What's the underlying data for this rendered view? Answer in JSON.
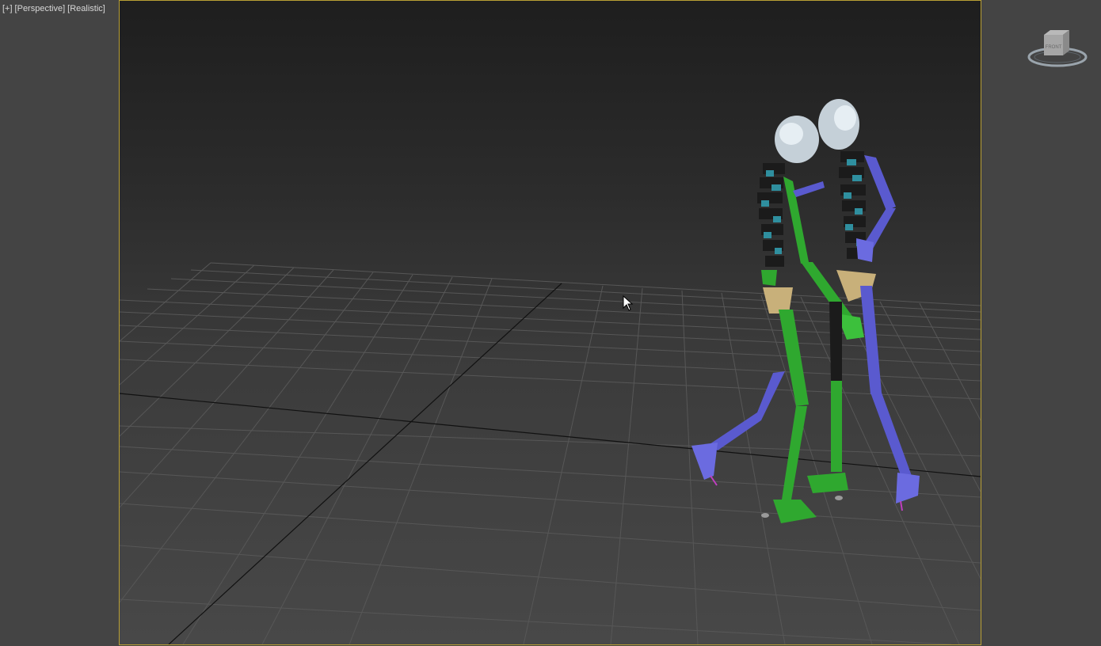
{
  "viewport_menu": {
    "plus_label": "[+]",
    "view_label": "[Perspective]",
    "shading_label": "[Realistic]"
  },
  "viewcube": {
    "face_label": "FRONT",
    "icon": "viewcube-icon"
  },
  "scene": {
    "objects": [
      {
        "name": "biped-skeleton-left",
        "colors": [
          "#2fa82f",
          "#5a5acf",
          "#2f8f9f"
        ]
      },
      {
        "name": "biped-skeleton-right",
        "colors": [
          "#5a5acf",
          "#2fa82f",
          "#2f8f9f"
        ]
      }
    ],
    "active_border_color": "#b9a035",
    "background_top": "#1e1e1e",
    "background_bottom": "#484848"
  },
  "cursor": {
    "icon": "mouse-pointer-icon"
  }
}
